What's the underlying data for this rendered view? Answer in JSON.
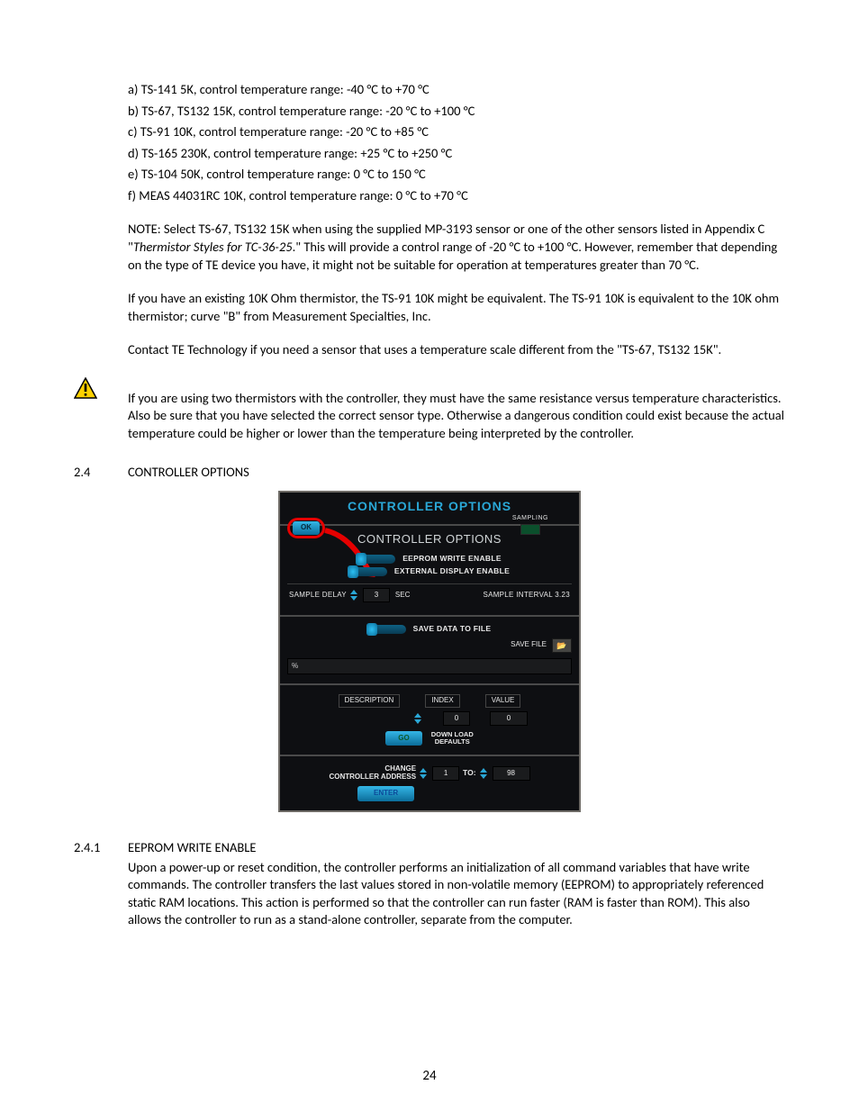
{
  "list": {
    "a": "a) TS-141 5K, control temperature range: -40 °C to +70 °C",
    "b": "b) TS-67, TS132 15K, control temperature range: -20 °C to +100 °C",
    "c": "c) TS-91 10K, control temperature range: -20 °C to +85 °C",
    "d": "d) TS-165 230K, control temperature range: +25 °C to +250 °C",
    "e": "e) TS-104 50K, control temperature range: 0 °C to 150 °C",
    "f": "f) MEAS 44031RC 10K, control temperature range: 0 °C to +70 °C"
  },
  "note": {
    "lead": "NOTE: Select TS-67, TS132 15K when using the supplied MP-3193 sensor or one of the other sensors listed in Appendix C \"",
    "italic": "Thermistor Styles for TC-36-25",
    "tail": ".\"  This will provide a control range of -20 °C to +100 °C.  However, remember that depending on the type of TE device you have, it might not be suitable for operation at temperatures greater than 70 °C."
  },
  "p2": "If you have an existing 10K Ohm thermistor, the TS-91 10K might be equivalent. The TS-91 10K is equivalent to the 10K ohm thermistor; curve \"B\" from Measurement Specialties, Inc.",
  "p3": "Contact TE Technology if you need a sensor that uses a temperature scale different from the \"TS-67, TS132 15K\".",
  "warn": "If you are using two thermistors with the controller, they must have the same resistance versus temperature characteristics. Also be sure that you have selected the correct sensor type. Otherwise a dangerous condition could exist because the actual temperature could be higher or lower than the temperature being interpreted by the controller.",
  "sec24": {
    "num": "2.4",
    "title": "CONTROLLER OPTIONS"
  },
  "sec241": {
    "num": "2.4.1",
    "title": "EEPROM WRITE ENABLE",
    "body": "Upon a power-up or reset condition, the controller performs an initialization of all command variables that have write commands.  The controller transfers the last values stored in non-volatile memory (EEPROM) to appropriately referenced static RAM locations.  This action is performed so that the controller can run faster (RAM is faster than ROM). This also allows the controller to run as a stand-alone controller, separate from the computer."
  },
  "page_number": "24",
  "ui": {
    "banner_title": "CONTROLLER OPTIONS",
    "ok": "OK",
    "sampling": "SAMPLING",
    "subtitle": "CONTROLLER OPTIONS",
    "eeprom": "EEPROM WRITE ENABLE",
    "ext_disp": "EXTERNAL DISPLAY ENABLE",
    "sample_delay_lbl": "SAMPLE DELAY",
    "sample_delay_val": "3",
    "sec": "SEC",
    "sample_interval": "SAMPLE INTERVAL 3.23",
    "save_data": "SAVE DATA TO FILE",
    "save_file": "SAVE FILE",
    "path": "%",
    "desc_hdr": "DESCRIPTION",
    "index_hdr": "INDEX",
    "value_hdr": "VALUE",
    "index_val": "0",
    "value_val": "0",
    "go": "GO",
    "download_defaults": "DOWN LOAD\nDEFAULTS",
    "change_addr": "CHANGE\nCONTROLLER ADDRESS",
    "addr_from": "1",
    "to": "TO:",
    "addr_to": "98",
    "enter": "ENTER"
  }
}
